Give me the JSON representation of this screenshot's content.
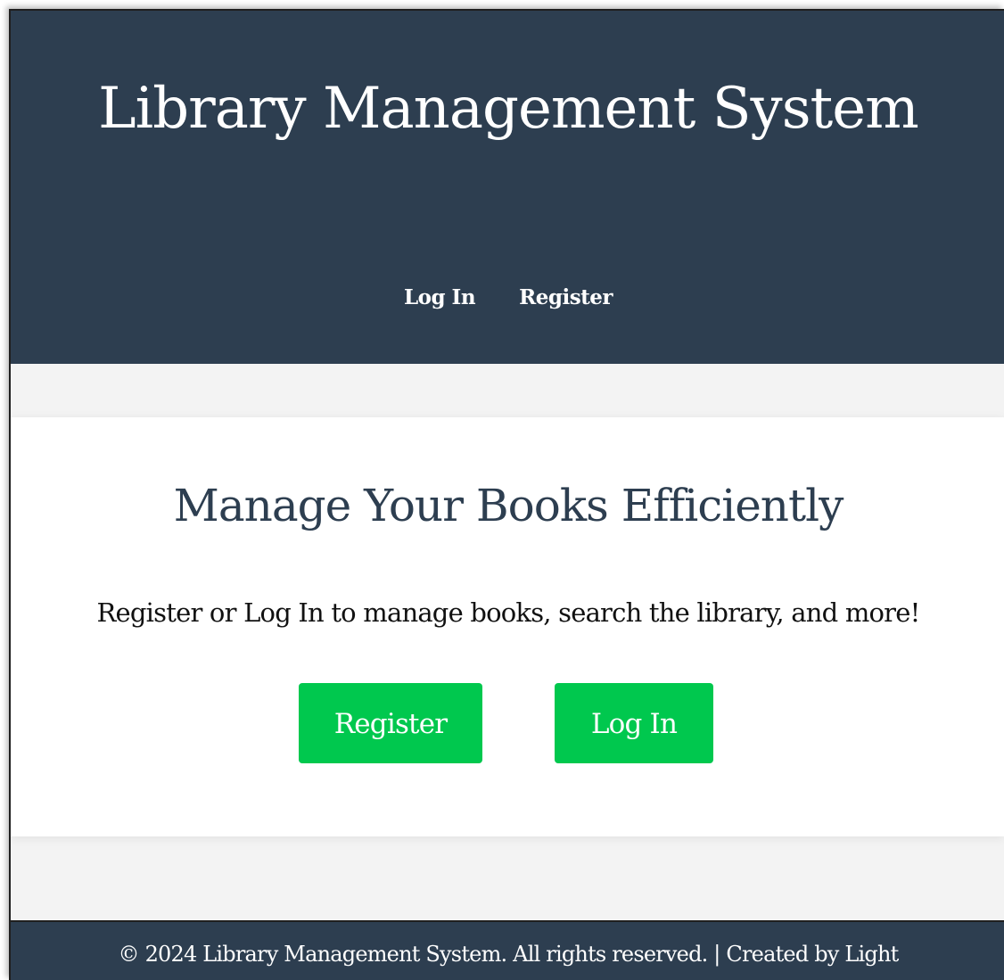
{
  "header": {
    "title": "Library Management System",
    "nav": {
      "login_label": "Log In",
      "register_label": "Register"
    }
  },
  "hero": {
    "title": "Manage Your Books Efficiently",
    "subtitle": "Register or Log In to manage books, search the library, and more!",
    "register_button_label": "Register",
    "login_button_label": "Log In"
  },
  "footer": {
    "text": "© 2024 Library Management System. All rights reserved. | Created by Light"
  },
  "colors": {
    "header_background": "#2d3e50",
    "page_background": "#f3f3f3",
    "card_background": "#ffffff",
    "primary_button": "#00c84e",
    "hero_title": "#2d3e50",
    "text": "#111111"
  }
}
